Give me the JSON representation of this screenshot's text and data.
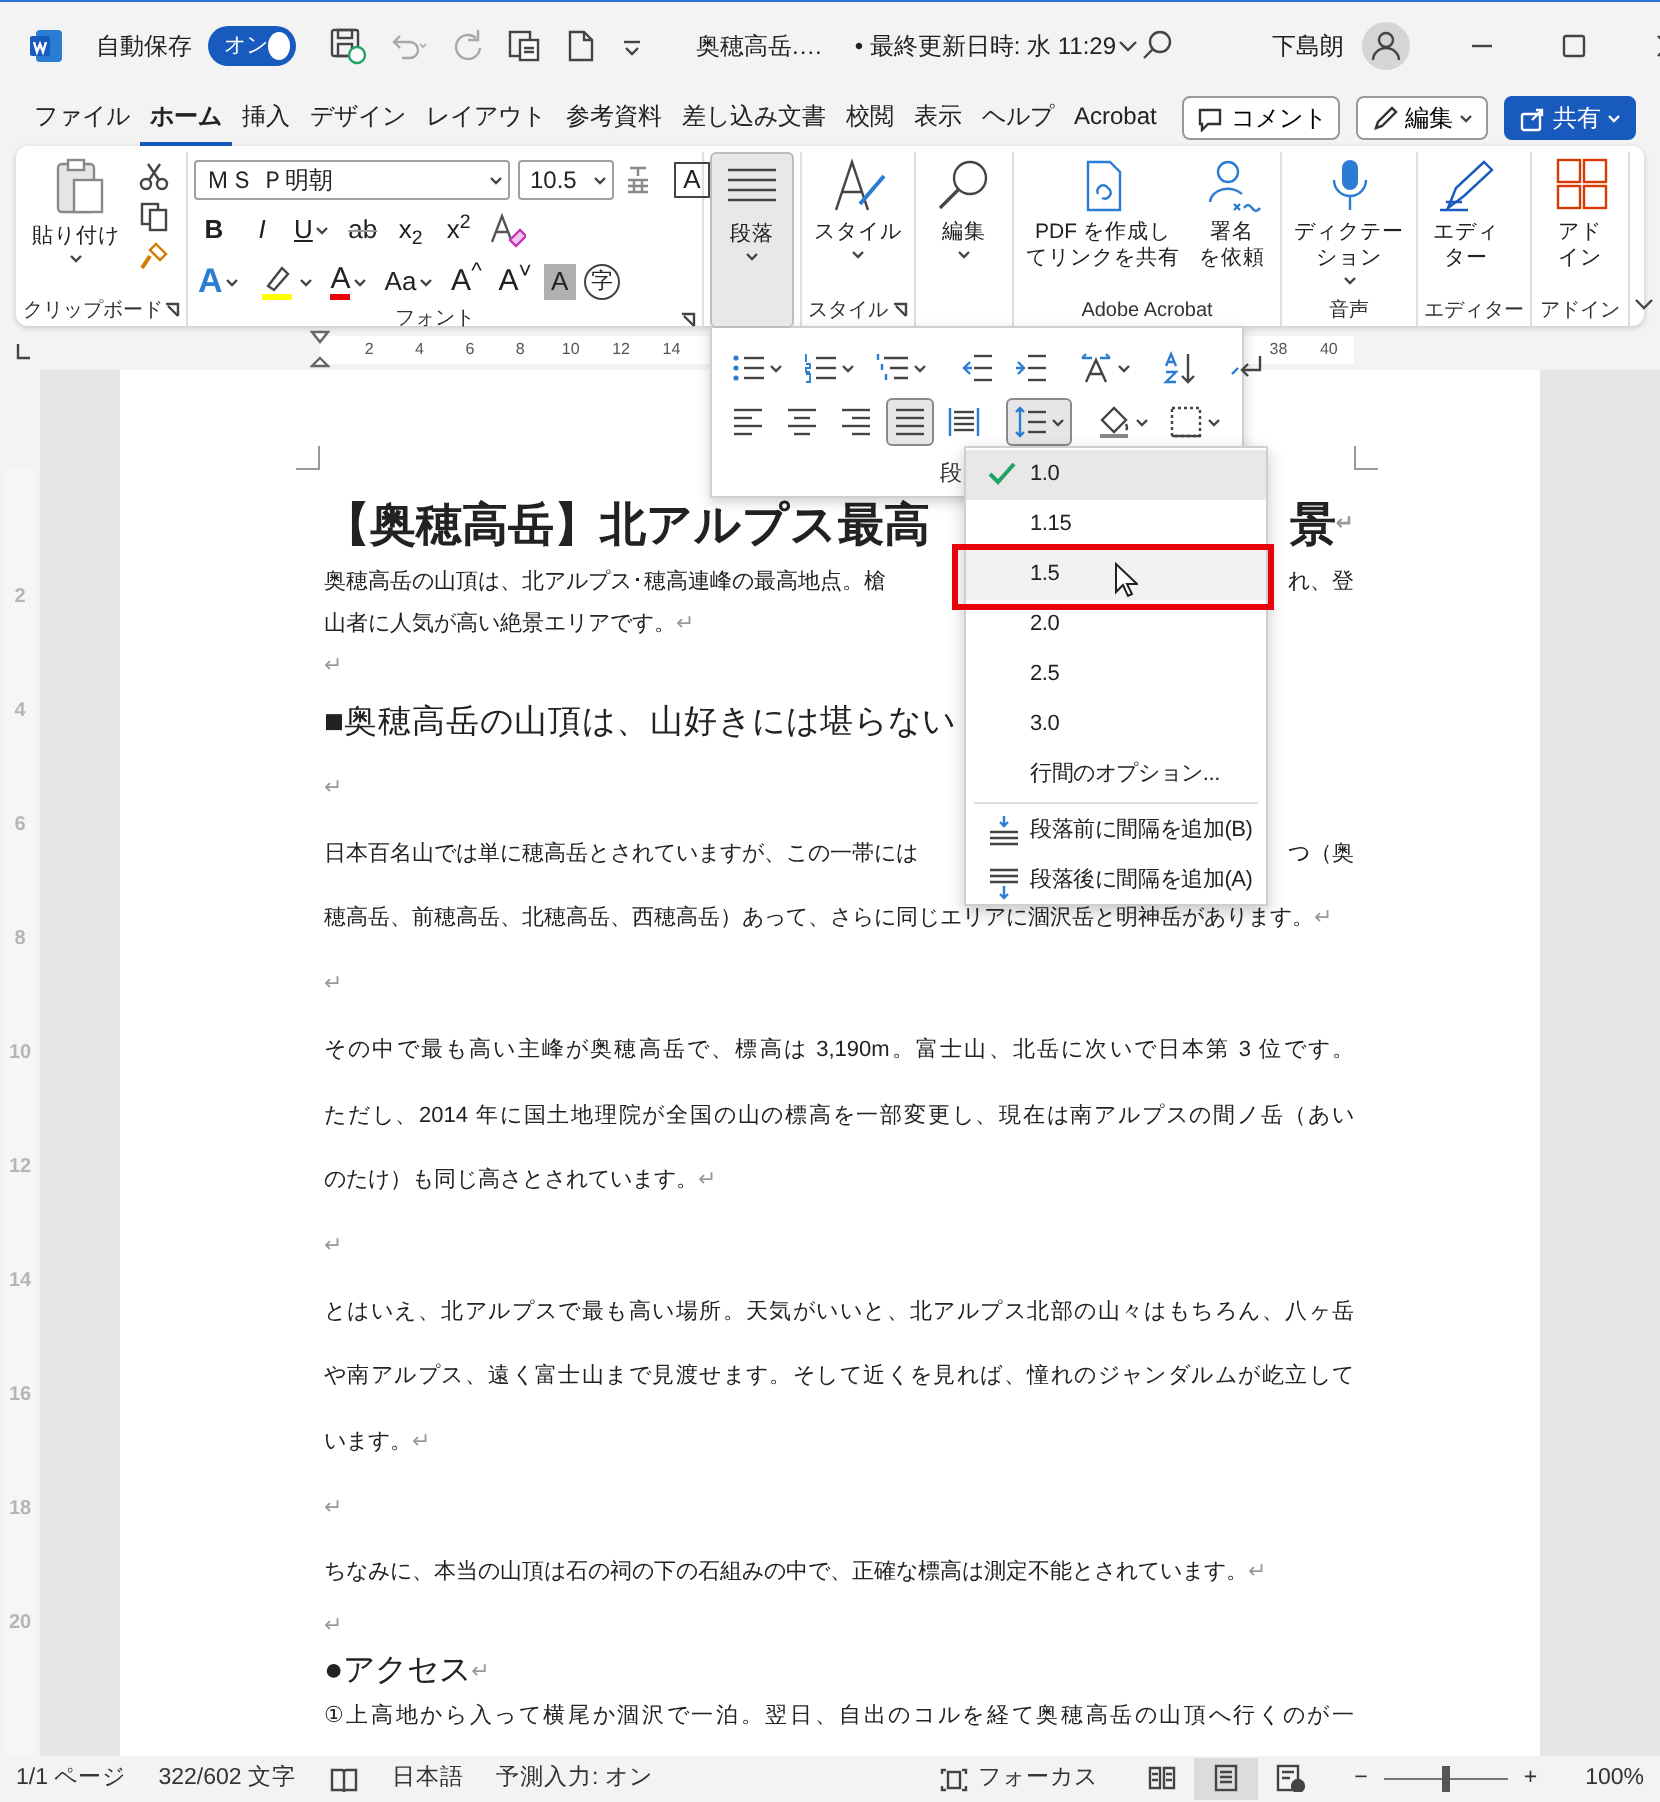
{
  "title_bar": {
    "autosave_label": "自動保存",
    "autosave_toggle": {
      "label": "オン",
      "on": true
    },
    "quick_access": [
      {
        "kind": "save",
        "disabled": false
      },
      {
        "kind": "undo",
        "disabled": true
      },
      {
        "kind": "redo",
        "disabled": true
      },
      {
        "kind": "screenshot",
        "disabled": false
      },
      {
        "kind": "new",
        "disabled": false
      },
      {
        "kind": "customize",
        "disabled": false
      }
    ],
    "document_name": "奥穂高岳.…",
    "saved_info": "• 最終更新日時: 水 11:29",
    "user_name": "下島朗"
  },
  "menu_tabs": [
    {
      "label": "ファイル",
      "selected": false
    },
    {
      "label": "ホーム",
      "selected": true
    },
    {
      "label": "挿入",
      "selected": false
    },
    {
      "label": "デザイン",
      "selected": false
    },
    {
      "label": "レイアウト",
      "selected": false
    },
    {
      "label": "参考資料",
      "selected": false
    },
    {
      "label": "差し込み文書",
      "selected": false
    },
    {
      "label": "校閲",
      "selected": false
    },
    {
      "label": "表示",
      "selected": false
    },
    {
      "label": "ヘルプ",
      "selected": false
    },
    {
      "label": "Acrobat",
      "selected": false
    }
  ],
  "menu_actions": [
    {
      "kind": "comment",
      "label": "コメント"
    },
    {
      "kind": "edit",
      "label": "編集"
    },
    {
      "kind": "share",
      "label": "共有"
    }
  ],
  "ribbon": {
    "groups": [
      {
        "kind": "clipboard",
        "label": "クリップボード",
        "launcher": true,
        "paste_label": "貼り付け"
      },
      {
        "kind": "font",
        "label": "フォント",
        "launcher": true,
        "font_name": "ＭＳ Ｐ明朝",
        "font_size": "10.5",
        "row1": [
          {
            "kind": "bold",
            "label": "B",
            "caret": false
          },
          {
            "kind": "italic",
            "label": "I",
            "caret": false
          },
          {
            "kind": "underline",
            "label": "U",
            "caret": true
          },
          {
            "kind": "strike",
            "label": "ab",
            "caret": false
          },
          {
            "kind": "script",
            "label": "x$_{2}$",
            "caret": false
          },
          {
            "kind": "script",
            "label": "x$^{2}$",
            "caret": false
          },
          {
            "kind": "clear",
            "caret": false
          }
        ],
        "row2": [
          {
            "kind": "effects",
            "label": "A",
            "caret": true
          },
          {
            "kind": "highlight",
            "caret": true
          },
          {
            "kind": "font-color",
            "label": "A",
            "caret": true
          },
          {
            "kind": "case",
            "label": "Aa",
            "caret": true
          },
          {
            "kind": "grow",
            "label": "A$^{^}$",
            "caret": false
          },
          {
            "kind": "shrink",
            "label": "A$^{˅}$",
            "caret": false
          },
          {
            "kind": "shade",
            "label": "A",
            "caret": false
          },
          {
            "kind": "enclose",
            "label": "字",
            "caret": false
          }
        ],
        "border_char": "A"
      },
      {
        "kind": "buttons",
        "launcher": false,
        "buttons": [
          {
            "kind": "paragraph",
            "label_lines": [
              "段落"
            ],
            "selected": true,
            "caret": true
          }
        ]
      },
      {
        "kind": "buttons",
        "label": "スタイル",
        "launcher": true,
        "buttons": [
          {
            "kind": "styles",
            "label_lines": [
              "スタイル"
            ],
            "selected": false,
            "caret": true
          }
        ]
      },
      {
        "kind": "buttons",
        "launcher": false,
        "buttons": [
          {
            "kind": "find",
            "label_lines": [
              "編集"
            ],
            "selected": false,
            "caret": true
          }
        ]
      },
      {
        "kind": "buttons",
        "label": "Adobe Acrobat",
        "launcher": false,
        "buttons": [
          {
            "kind": "pdf",
            "label_lines": [
              "PDF を作成し",
              "てリンクを共有"
            ],
            "selected": false,
            "caret": false
          },
          {
            "kind": "sign",
            "label_lines": [
              "署名",
              "を依頼"
            ],
            "selected": false,
            "caret": false
          }
        ]
      },
      {
        "kind": "buttons",
        "label": "音声",
        "launcher": false,
        "buttons": [
          {
            "kind": "dictate",
            "label_lines": [
              "ディクテー",
              "ション"
            ],
            "selected": false,
            "caret": true
          }
        ]
      },
      {
        "kind": "buttons",
        "label": "エディター",
        "launcher": false,
        "buttons": [
          {
            "kind": "editor",
            "label_lines": [
              "エディ",
              "ター"
            ],
            "selected": false,
            "caret": false
          }
        ]
      },
      {
        "kind": "buttons",
        "label": "アドイン",
        "launcher": false,
        "buttons": [
          {
            "kind": "addins",
            "label_lines": [
              "アド",
              "イン"
            ],
            "selected": false,
            "caret": false
          }
        ]
      }
    ]
  },
  "ruler": {
    "left_labels": [
      "2",
      "4",
      "6",
      "8",
      "10",
      "12",
      "14"
    ],
    "right_labels": [
      "38",
      "40"
    ]
  },
  "vertical_ruler": [
    "2",
    "4",
    "6",
    "8",
    "10",
    "12",
    "14",
    "16",
    "18",
    "20"
  ],
  "document": {
    "lines": [
      {
        "kind": "title",
        "text": "【奥穂高岳】北アルプス最高",
        "text_right": "景",
        "end": "↵"
      },
      {
        "kind": "compact",
        "text": "奥穂高岳の山頂は、北アルプス･穂高連峰の最高地点。槍",
        "text_right": "れ、登"
      },
      {
        "kind": "compact",
        "text": "山者に人気が高い絶景エリアです。",
        "end": "↵"
      },
      {
        "kind": "compact",
        "end": "↵"
      },
      {
        "kind": "heading",
        "text": "■奥穂高岳の山頂は、山好きには堪らない"
      },
      {
        "kind": "body",
        "end": "↵"
      },
      {
        "kind": "body",
        "text": "日本百名山では単に穂高岳とされていますが、この一帯には",
        "text_right": "つ（奥"
      },
      {
        "kind": "body",
        "text": "穂高岳、前穂高岳、北穂高岳、西穂高岳）あって、さらに同じエリアに涸沢岳と明神岳があります。",
        "end": "↵"
      },
      {
        "kind": "body",
        "end": "↵"
      },
      {
        "kind": "body",
        "text": "その中で最も高い主峰が奥穂高岳で、標高は 3,190m。富士山、北岳に次いで日本第 3 位です。"
      },
      {
        "kind": "body",
        "text": "ただし、2014 年に国土地理院が全国の山の標高を一部変更し、現在は南アルプスの間ノ岳（あい"
      },
      {
        "kind": "body",
        "text": "のたけ）も同じ高さとされています。",
        "end": "↵"
      },
      {
        "kind": "body",
        "end": "↵"
      },
      {
        "kind": "body",
        "text": "とはいえ、北アルプスで最も高い場所。天気がいいと、北アルプス北部の山々はもちろん、八ヶ岳"
      },
      {
        "kind": "body",
        "text": "や南アルプス、遠く富士山まで見渡せます。そして近くを見れば、憧れのジャンダルムが屹立して"
      },
      {
        "kind": "body",
        "text": "います。",
        "end": "↵"
      },
      {
        "kind": "body",
        "end": "↵"
      },
      {
        "kind": "body",
        "text": "ちなみに、本当の山頂は石の祠の下の石組みの中で、正確な標高は測定不能とされています。",
        "end": "↵"
      },
      {
        "kind": "compact",
        "end": "↵"
      },
      {
        "kind": "subheading",
        "text": "●アクセス",
        "end": "↵"
      },
      {
        "kind": "compact",
        "text": "①上高地から入って横尾か涸沢で一泊。翌日、自出のコルを経て奥穂高岳の山頂へ行くのが一"
      }
    ]
  },
  "paragraph_popup": {
    "label": "段",
    "rows": [
      [
        {
          "kind": "bullets",
          "caret": true,
          "selected": false
        },
        {
          "kind": "numbering",
          "caret": true,
          "selected": false
        },
        {
          "kind": "multilevel",
          "caret": true,
          "selected": false
        },
        {
          "kind": "outdent",
          "caret": false,
          "selected": false
        },
        {
          "kind": "indent",
          "caret": false,
          "selected": false
        },
        {
          "kind": "asian",
          "caret": true,
          "selected": false
        },
        {
          "kind": "sort",
          "caret": false,
          "selected": false
        },
        {
          "kind": "marks",
          "caret": false,
          "selected": false
        }
      ],
      [
        {
          "kind": "align-left",
          "caret": false,
          "selected": false
        },
        {
          "kind": "align-center",
          "caret": false,
          "selected": false
        },
        {
          "kind": "align-right",
          "caret": false,
          "selected": false
        },
        {
          "kind": "justify",
          "caret": false,
          "selected": true
        },
        {
          "kind": "distribute",
          "caret": false,
          "selected": false
        },
        {
          "kind": "line-spacing",
          "caret": true,
          "selected": true
        },
        {
          "kind": "shading",
          "caret": true,
          "selected": false
        },
        {
          "kind": "borders",
          "caret": true,
          "selected": false
        }
      ]
    ]
  },
  "line_spacing_menu": {
    "items": [
      {
        "kind": "value",
        "label": "1.0",
        "checked": true,
        "hovered": false,
        "annotated": false
      },
      {
        "kind": "value",
        "label": "1.15",
        "checked": false,
        "hovered": false,
        "annotated": false
      },
      {
        "kind": "value",
        "label": "1.5",
        "checked": false,
        "hovered": true,
        "annotated": true
      },
      {
        "kind": "value",
        "label": "2.0",
        "checked": false,
        "hovered": false,
        "annotated": false
      },
      {
        "kind": "value",
        "label": "2.5",
        "checked": false,
        "hovered": false,
        "annotated": false
      },
      {
        "kind": "value",
        "label": "3.0",
        "checked": false,
        "hovered": false,
        "annotated": false
      },
      {
        "kind": "option",
        "label": "行間のオプション...",
        "checked": false,
        "hovered": false,
        "annotated": false
      },
      {
        "kind": "before",
        "label": "段落前に間隔を追加(B)",
        "checked": false,
        "hovered": false,
        "annotated": false
      },
      {
        "kind": "after",
        "label": "段落後に間隔を追加(A)",
        "checked": false,
        "hovered": false,
        "annotated": false
      }
    ]
  },
  "status_bar": {
    "page": "1/1 ページ",
    "words": "322/602 文字",
    "language": "日本語",
    "prediction": "予測入力: オン",
    "focus": "フォーカス",
    "views": [
      {
        "kind": "read",
        "selected": false
      },
      {
        "kind": "print",
        "selected": true
      },
      {
        "kind": "web",
        "selected": false
      }
    ],
    "zoom_out": "−",
    "zoom_in": "+",
    "zoom": {
      "level": 0.5
    },
    "zoom_label": "100%"
  }
}
